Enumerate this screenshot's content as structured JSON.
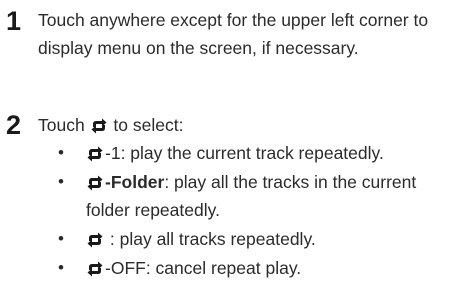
{
  "step1": {
    "number": "1",
    "text": "Touch anywhere except for the upper left corner to display menu on the screen, if necessary."
  },
  "step2": {
    "number": "2",
    "text_before": "Touch ",
    "text_after": " to select:"
  },
  "bullets": [
    {
      "dot": "•",
      "label": "-1",
      "desc": ": play the current track repeatedly.",
      "icon": "repeat-icon"
    },
    {
      "dot": "•",
      "label": "-Folder",
      "desc": ": play all the tracks in the current folder repeatedly.",
      "icon": "repeat-icon"
    },
    {
      "dot": "•",
      "label": " ",
      "desc": ": play all tracks repeatedly.",
      "icon": "repeat-icon"
    },
    {
      "dot": "•",
      "label": "-OFF",
      "desc": ": cancel repeat play.",
      "icon": "repeat-icon"
    }
  ]
}
